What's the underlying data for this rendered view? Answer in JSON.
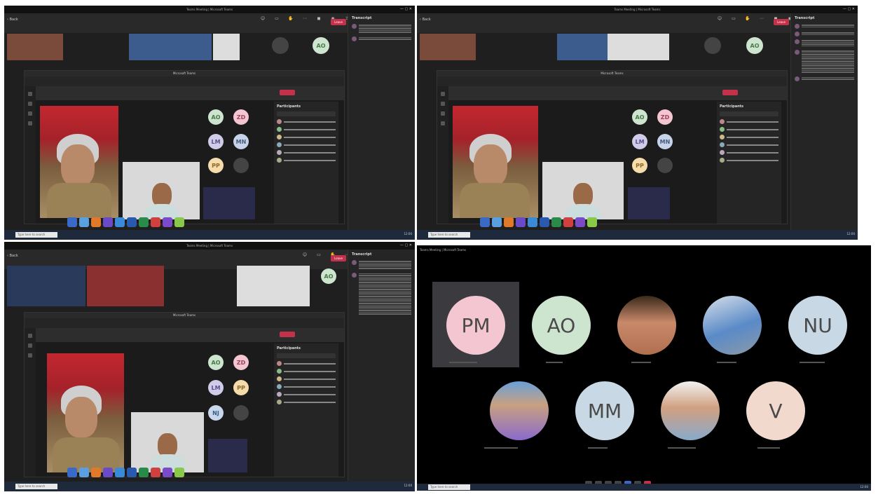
{
  "window_title": "Teams Meeting | Microsoft Teams",
  "meeting_bar": {
    "back_label": "Back",
    "leave_label": "Leave",
    "transcript_title": "Transcript",
    "participants_title": "Participants",
    "inner_window_title": "Microsoft Teams",
    "inner_app_title": "Microsoft Teams"
  },
  "taskbar": {
    "search_placeholder": "Type here to search",
    "clock": "12:00"
  },
  "gallery": {
    "initials": {
      "ao": "AO",
      "zd": "ZD",
      "lm": "LM",
      "mn": "MN",
      "pp": "PP",
      "nj": "NJ"
    }
  },
  "q4": {
    "title": "Teams Meeting | Microsoft Teams",
    "tiles": [
      {
        "initials": "PM",
        "color": "#f4c6d2"
      },
      {
        "initials": "AO",
        "color": "#cde5cf"
      },
      {
        "initials": "NU",
        "color": "#c8d8e4"
      },
      {
        "initials": "MM",
        "color": "#c8d8e4"
      },
      {
        "initials": "V",
        "color": "#f1d9ce"
      }
    ]
  }
}
